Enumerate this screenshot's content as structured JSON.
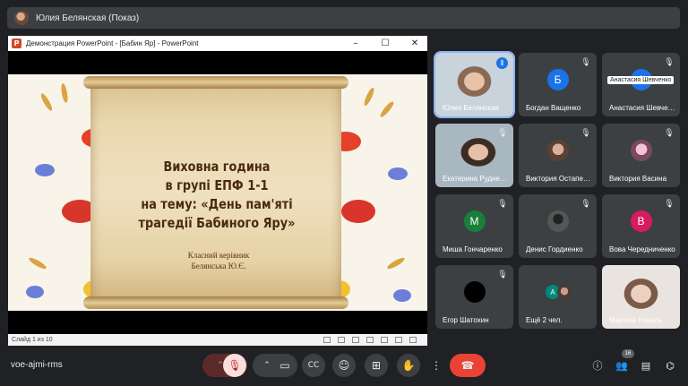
{
  "presenter_bar": {
    "label": "Юлия Белянская (Показ)"
  },
  "ppt_window": {
    "title": "Демонстрация PowerPoint - [Бабин Яр] - PowerPoint",
    "logo_letter": "P",
    "minimize_icon": "–",
    "maximize_icon": "☐",
    "close_icon": "✕",
    "status_text": "Слайд 1 из 10"
  },
  "slide": {
    "heading_lines": [
      "Виховна година",
      "в групі ЕПФ 1-1",
      "на тему: «День пам'яті",
      "трагедії Бабиного Яру»"
    ],
    "teacher_role": "Класний керівник",
    "teacher_name": "Белянська Ю.Є."
  },
  "participants": [
    {
      "name": "Юлия Белянская",
      "initial": "",
      "color": "",
      "speaking": true
    },
    {
      "name": "Богдан Ващенко",
      "initial": "Б",
      "color": "#1a73e8"
    },
    {
      "name": "Анастасия Шевченко",
      "initial": "А",
      "color": "#1a73e8",
      "hover": "Анастасия Шевченко"
    },
    {
      "name": "Екатерина Рудненко",
      "initial": "",
      "color": ""
    },
    {
      "name": "Виктория Остапенко",
      "initial": "",
      "color": ""
    },
    {
      "name": "Виктория Васина",
      "initial": "",
      "color": ""
    },
    {
      "name": "Миша Гончаренко",
      "initial": "М",
      "color": "#188038"
    },
    {
      "name": "Денис Гордиенко",
      "initial": "",
      "color": ""
    },
    {
      "name": "Вова Чередниченко",
      "initial": "В",
      "color": "#d81b60"
    },
    {
      "name": "Егор Шатохин",
      "initial": "",
      "color": "#000000"
    },
    {
      "name": "Ещё 2 чел.",
      "initial": "А",
      "color": "#00897b"
    },
    {
      "name": "Мар'яна Коваль",
      "initial": "",
      "color": ""
    }
  ],
  "bottom_bar": {
    "meeting_code": "voe-ajmi-rms",
    "participant_count": "16"
  },
  "colors": {
    "background": "#202124",
    "tile": "#3c4043",
    "accent": "#8ab4f8",
    "end_call": "#ea4335"
  }
}
